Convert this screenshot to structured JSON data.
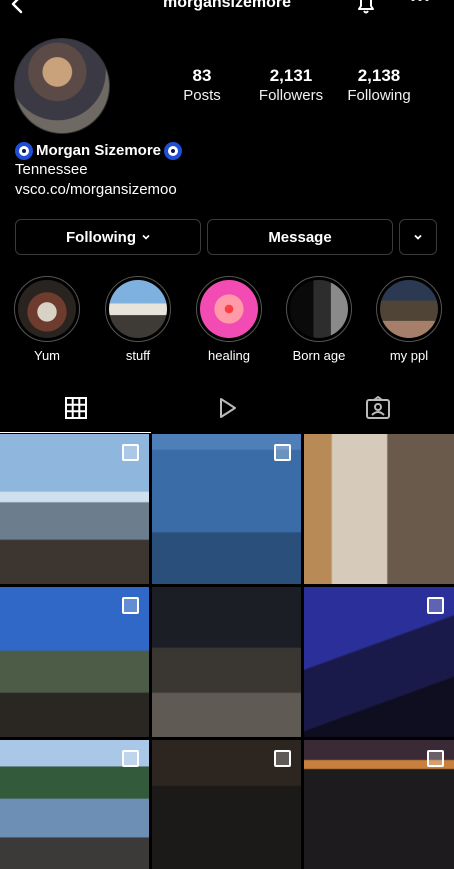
{
  "header": {
    "username": "morgansizemore"
  },
  "profile": {
    "stats": [
      {
        "value": "83",
        "label": "Posts"
      },
      {
        "value": "2,131",
        "label": "Followers"
      },
      {
        "value": "2,138",
        "label": "Following"
      }
    ],
    "name": "Morgan Sizemore",
    "location": "Tennessee",
    "link": "vsco.co/morgansizemoo"
  },
  "buttons": {
    "following": "Following",
    "message": "Message"
  },
  "highlights": [
    "Yum",
    "stuff",
    "healing",
    "Born   age",
    "my ppl"
  ],
  "icons": {
    "back": "chevron-left-icon",
    "bell": "bell-icon",
    "more": "more-icon",
    "grid_tab": "grid-icon",
    "reels_tab": "reels-icon",
    "tagged_tab": "tagged-icon"
  }
}
